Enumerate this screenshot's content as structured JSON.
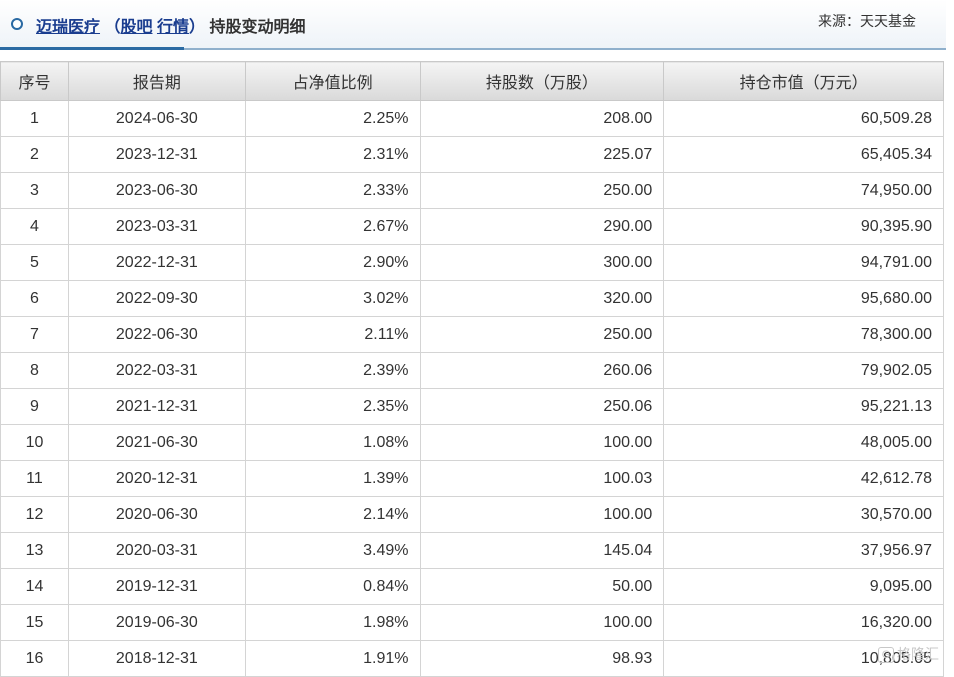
{
  "header": {
    "stock_name": "迈瑞医疗",
    "open_paren": "（",
    "link_guba": "股吧",
    "link_hangqing": "行情",
    "close_paren": "）",
    "subtitle": "持股变动明细",
    "source": "来源：天天基金"
  },
  "table": {
    "columns": [
      "序号",
      "报告期",
      "占净值比例",
      "持股数（万股）",
      "持仓市值（万元）"
    ],
    "rows": [
      [
        "1",
        "2024-06-30",
        "2.25%",
        "208.00",
        "60,509.28"
      ],
      [
        "2",
        "2023-12-31",
        "2.31%",
        "225.07",
        "65,405.34"
      ],
      [
        "3",
        "2023-06-30",
        "2.33%",
        "250.00",
        "74,950.00"
      ],
      [
        "4",
        "2023-03-31",
        "2.67%",
        "290.00",
        "90,395.90"
      ],
      [
        "5",
        "2022-12-31",
        "2.90%",
        "300.00",
        "94,791.00"
      ],
      [
        "6",
        "2022-09-30",
        "3.02%",
        "320.00",
        "95,680.00"
      ],
      [
        "7",
        "2022-06-30",
        "2.11%",
        "250.00",
        "78,300.00"
      ],
      [
        "8",
        "2022-03-31",
        "2.39%",
        "260.06",
        "79,902.05"
      ],
      [
        "9",
        "2021-12-31",
        "2.35%",
        "250.06",
        "95,221.13"
      ],
      [
        "10",
        "2021-06-30",
        "1.08%",
        "100.00",
        "48,005.00"
      ],
      [
        "11",
        "2020-12-31",
        "1.39%",
        "100.03",
        "42,612.78"
      ],
      [
        "12",
        "2020-06-30",
        "2.14%",
        "100.00",
        "30,570.00"
      ],
      [
        "13",
        "2020-03-31",
        "3.49%",
        "145.04",
        "37,956.97"
      ],
      [
        "14",
        "2019-12-31",
        "0.84%",
        "50.00",
        "9,095.00"
      ],
      [
        "15",
        "2019-06-30",
        "1.98%",
        "100.00",
        "16,320.00"
      ],
      [
        "16",
        "2018-12-31",
        "1.91%",
        "98.93",
        "10,805.05"
      ]
    ]
  },
  "watermark": {
    "badge": "G",
    "text": "格隆汇"
  }
}
